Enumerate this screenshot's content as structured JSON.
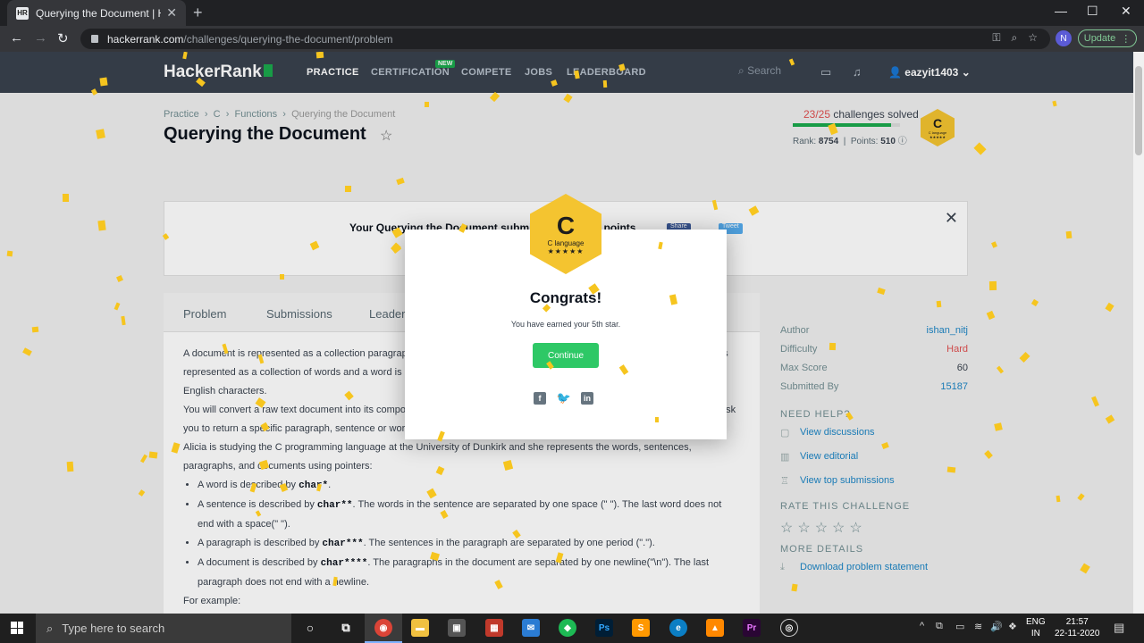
{
  "browser": {
    "tab_title": "Querying the Document | Hacker",
    "tab_favicon": "HR",
    "url_domain": "hackerrank.com",
    "url_path": "/challenges/querying-the-document/problem",
    "profile_initial": "N",
    "update_label": "Update"
  },
  "nav": {
    "logo": "HackerRank",
    "links": [
      "PRACTICE",
      "CERTIFICATION",
      "COMPETE",
      "JOBS",
      "LEADERBOARD"
    ],
    "new_badge": "NEW",
    "search_placeholder": "Search",
    "username": "eazyit1403"
  },
  "breadcrumb": [
    "Practice",
    "C",
    "Functions",
    "Querying the Document"
  ],
  "page_title": "Querying the Document",
  "progress": {
    "solved": "23/25",
    "solved_suffix": " challenges solved",
    "fraction": 0.92,
    "rank_label": "Rank:",
    "rank": "8754",
    "points_label": "Points:",
    "points": "510"
  },
  "badge_small": {
    "letter": "C",
    "label": "C language",
    "stars": "★★★★★"
  },
  "banner": {
    "text": "Your Querying the Document submission got 100 points.",
    "share": "Share",
    "tweet": "Tweet"
  },
  "tabs": [
    "Problem",
    "Submissions",
    "Leaderboard"
  ],
  "problem": {
    "p1": "A document is represented as a collection paragraphs, a paragraph is represented as a collection of sentences, a sentence is represented as a collection of words and a word is represented as a collection of lower-case ([a-z]) and upper-case ([A-Z]) English characters.",
    "p2": "You will convert a raw text document into its component paragraphs, sentences and words. To test your results, queries will ask you to return a specific paragraph, sentence or word.",
    "p3": "Alicia is studying the C programming language at the University of Dunkirk and she represents the words, sentences, paragraphs, and documents using pointers:",
    "b1_pre": "A word is described by ",
    "b1_code": "char*",
    "b1_post": ".",
    "b2_pre": "A sentence is described by ",
    "b2_code": "char**",
    "b2_post": ". The words in the sentence are separated by one space (\" \"). The last word does not end with a space(\" \").",
    "b3_pre": "A paragraph is described by ",
    "b3_code": "char***",
    "b3_post": ". The sentences in the paragraph are separated by one period (\".\").",
    "b4_pre": "A document is described by ",
    "b4_code": "char****",
    "b4_post": ". The paragraphs in the document are separated by one newline(\"\\n\"). The last paragraph does not end with a newline.",
    "p4": "For example:"
  },
  "sidebar": {
    "author_label": "Author",
    "author": "ishan_nitj",
    "difficulty_label": "Difficulty",
    "difficulty": "Hard",
    "max_score_label": "Max Score",
    "max_score": "60",
    "submitted_label": "Submitted By",
    "submitted": "15187",
    "need_help": "NEED HELP?",
    "help_links": [
      "View discussions",
      "View editorial",
      "View top submissions"
    ],
    "rate_heading": "RATE THIS CHALLENGE",
    "more_details": "MORE DETAILS",
    "download": "Download problem statement"
  },
  "modal": {
    "badge_letter": "C",
    "badge_label": "C language",
    "badge_stars": "★★★★★",
    "title": "Congrats!",
    "message": "You have earned your 5th star.",
    "continue": "Continue"
  },
  "taskbar": {
    "search_placeholder": "Type here to search",
    "lang": "ENG",
    "region": "IN",
    "time": "21:57",
    "date": "22-11-2020"
  },
  "colors": {
    "accent_green": "#2ec866",
    "gold": "#f4c430",
    "nav_bg": "#39424e"
  }
}
